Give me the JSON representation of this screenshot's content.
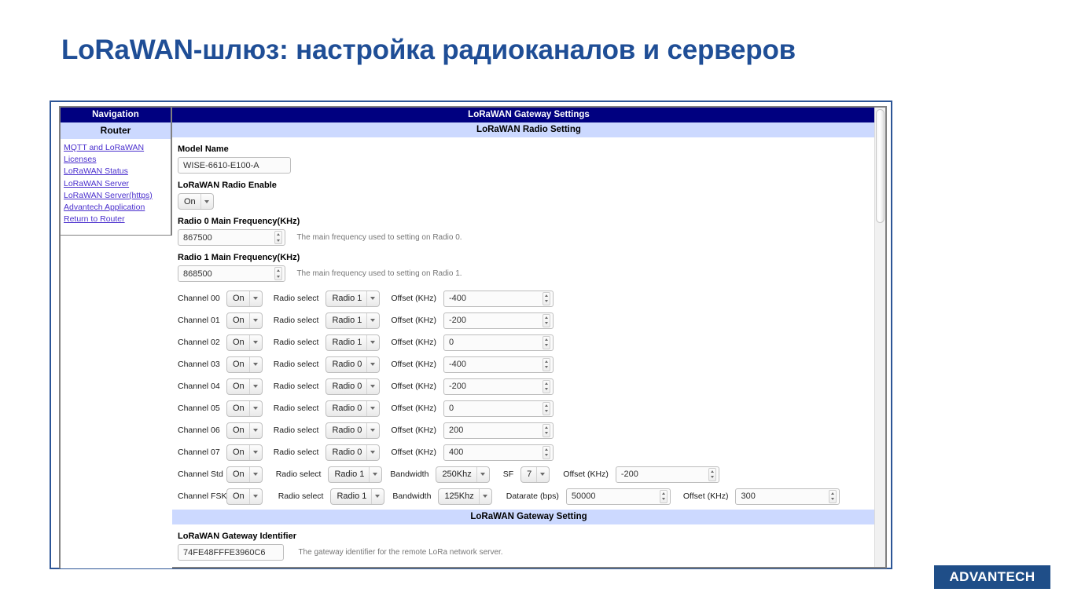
{
  "slide": {
    "title": "LoRaWAN-шлюз: настройка радиоканалов и серверов",
    "title_color": "#1f4e96"
  },
  "logo": {
    "text": "ADVANTECH",
    "bg": "#1f4e88"
  },
  "navigation": {
    "header": "Navigation",
    "subheader": "Router",
    "items": [
      {
        "label": "MQTT and LoRaWAN"
      },
      {
        "label": "Licenses"
      },
      {
        "label": "LoRaWAN Status"
      },
      {
        "label": "LoRaWAN Server"
      },
      {
        "label": "LoRaWAN Server(https)"
      },
      {
        "label": "Advantech Application"
      },
      {
        "label": "Return to Router"
      }
    ]
  },
  "page": {
    "title_bar": "LoRaWAN Gateway Settings",
    "radio_section": "LoRaWAN Radio Setting",
    "gateway_section": "LoRaWAN Gateway Setting",
    "model_name_label": "Model Name",
    "model_name_value": "WISE-6610-E100-A",
    "radio_enable_label": "LoRaWAN Radio Enable",
    "radio_enable_value": "On",
    "radio0_label": "Radio 0 Main Frequency(KHz)",
    "radio0_value": "867500",
    "radio0_hint": "The main frequency used to setting on Radio 0.",
    "radio1_label": "Radio 1 Main Frequency(KHz)",
    "radio1_value": "868500",
    "radio1_hint": "The main frequency used to setting on Radio 1.",
    "gateway_id_label": "LoRaWAN Gateway Identifier",
    "gateway_id_value": "74FE48FFFE3960C6",
    "gateway_id_hint": "The gateway identifier for the remote LoRa network server."
  },
  "labels": {
    "radio_select": "Radio select",
    "offset": "Offset (KHz)",
    "bandwidth": "Bandwidth",
    "sf": "SF",
    "datarate": "Datarate (bps)"
  },
  "channels": [
    {
      "name": "Channel 00",
      "enable": "On",
      "radio": "Radio 1",
      "offset": "-400"
    },
    {
      "name": "Channel 01",
      "enable": "On",
      "radio": "Radio 1",
      "offset": "-200"
    },
    {
      "name": "Channel 02",
      "enable": "On",
      "radio": "Radio 1",
      "offset": "0"
    },
    {
      "name": "Channel 03",
      "enable": "On",
      "radio": "Radio 0",
      "offset": "-400"
    },
    {
      "name": "Channel 04",
      "enable": "On",
      "radio": "Radio 0",
      "offset": "-200"
    },
    {
      "name": "Channel 05",
      "enable": "On",
      "radio": "Radio 0",
      "offset": "0"
    },
    {
      "name": "Channel 06",
      "enable": "On",
      "radio": "Radio 0",
      "offset": "200"
    },
    {
      "name": "Channel 07",
      "enable": "On",
      "radio": "Radio 0",
      "offset": "400"
    }
  ],
  "channel_std": {
    "name": "Channel Std",
    "enable": "On",
    "radio": "Radio 1",
    "bandwidth": "250Khz",
    "sf": "7",
    "offset": "-200"
  },
  "channel_fsk": {
    "name": "Channel FSK",
    "enable": "On",
    "radio": "Radio 1",
    "bandwidth": "125Khz",
    "datarate": "50000",
    "offset": "300"
  }
}
